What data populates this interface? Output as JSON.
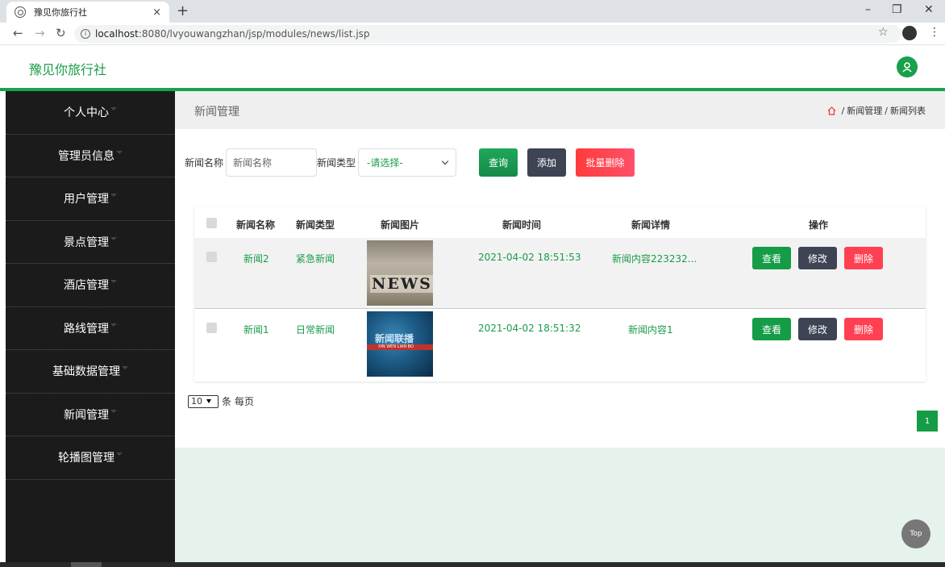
{
  "browser": {
    "tab_title": "豫见你旅行社",
    "tab_close": "×",
    "new_tab": "+",
    "url_host": "localhost",
    "url_rest": ":8080/lvyouwangzhan/jsp/modules/news/list.jsp"
  },
  "app": {
    "brand": "豫见你旅行社",
    "accent": "#1ba24a"
  },
  "sidebar": {
    "items": [
      {
        "label": "个人中心"
      },
      {
        "label": "管理员信息"
      },
      {
        "label": "用户管理"
      },
      {
        "label": "景点管理"
      },
      {
        "label": "酒店管理"
      },
      {
        "label": "路线管理"
      },
      {
        "label": "基础数据管理"
      },
      {
        "label": "新闻管理"
      },
      {
        "label": "轮播图管理"
      }
    ]
  },
  "page": {
    "title": "新闻管理",
    "breadcrumb": [
      "新闻管理",
      "新闻列表"
    ],
    "breadcrumb_sep": "/"
  },
  "filters": {
    "name_label": "新闻名称",
    "name_placeholder": "新闻名称",
    "type_label": "新闻类型",
    "type_selected": "-请选择-",
    "search_btn": "查询",
    "add_btn": "添加",
    "bulk_delete_btn": "批量删除"
  },
  "table": {
    "headers": [
      "新闻名称",
      "新闻类型",
      "新闻图片",
      "新闻时间",
      "新闻详情",
      "操作"
    ],
    "rows": [
      {
        "name": "新闻2",
        "type": "紧急新闻",
        "image_text": "NEWS",
        "time": "2021-04-02 18:51:53",
        "detail": "新闻内容223232..."
      },
      {
        "name": "新闻1",
        "type": "日常新闻",
        "image_text": "新闻联播",
        "image_sub": "XIN WEN LIAN BO",
        "time": "2021-04-02 18:51:32",
        "detail": "新闻内容1"
      }
    ],
    "actions": {
      "view": "查看",
      "edit": "修改",
      "delete": "删除"
    }
  },
  "pagination": {
    "page_size": "10",
    "page_size_suffix": "条 每页",
    "current_page": "1"
  },
  "top_button": "Top"
}
